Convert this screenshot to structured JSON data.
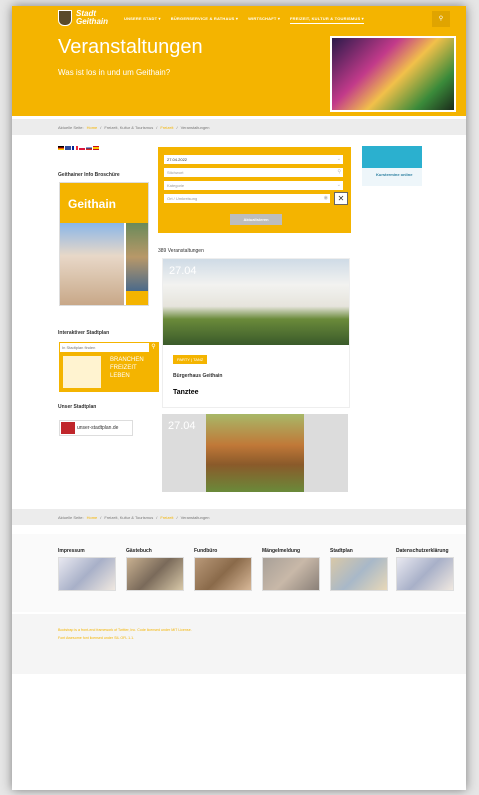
{
  "header": {
    "logo_line1": "Stadt",
    "logo_line2": "Geithain",
    "nav": [
      "UNSERE STADT ▾",
      "BÜRGERSERVICE & RATHAUS ▾",
      "WIRTSCHAFT ▾",
      "FREIZEIT, KULTUR & TOURISMUS ▾"
    ],
    "search_icon": "search-icon",
    "title": "Veranstaltungen",
    "subtitle": "Was ist los in und um Geithain?"
  },
  "breadcrumb": {
    "prefix": "Aktuelle Seite:",
    "items": [
      "Home",
      "/",
      "Freizeit, Kultur & Tourismus",
      "/",
      "Freizeit",
      "/",
      "Veranstaltungen"
    ]
  },
  "sidebar": {
    "brochure_heading": "Geithainer Info Broschüre",
    "brochure_title": "Geithain",
    "stadtplan_heading": "Interaktiver Stadtplan",
    "stadtplan_placeholder": "In Stadtplan finden",
    "stadtplan_text": [
      "BRANCHEN",
      "FREIZEIT",
      "LEBEN"
    ],
    "unser_heading": "Unser Stadtplan",
    "unser_link": "unser-stadtplan.de"
  },
  "form": {
    "date": "27.04.2022",
    "search_placeholder": "Stichwort",
    "category_placeholder": "Kategorie",
    "location_placeholder": "Ort / Umkreisung",
    "submit": "Aktualisieren",
    "clear": "✕"
  },
  "results": {
    "count": "389 Veranstaltungen",
    "events": [
      {
        "date": "27.04",
        "tag": "PARTY | TANZ",
        "location": "Bürgerhaus Geithain",
        "title": "Tanztee"
      },
      {
        "date": "27.04"
      }
    ]
  },
  "ad": {
    "text": "Kurstermine online"
  },
  "footer": {
    "links": [
      "Impressum",
      "Gästebuch",
      "Fundbüro",
      "Mängelmeldung",
      "Stadtplan",
      "Datenschutzerklärung"
    ],
    "credit_line1": "Bootstrap is a front-end framework of Twitter, Inc. Code licensed under MIT License.",
    "credit_line2": "Font Awesome font licensed under SIL OFL 1.1."
  }
}
